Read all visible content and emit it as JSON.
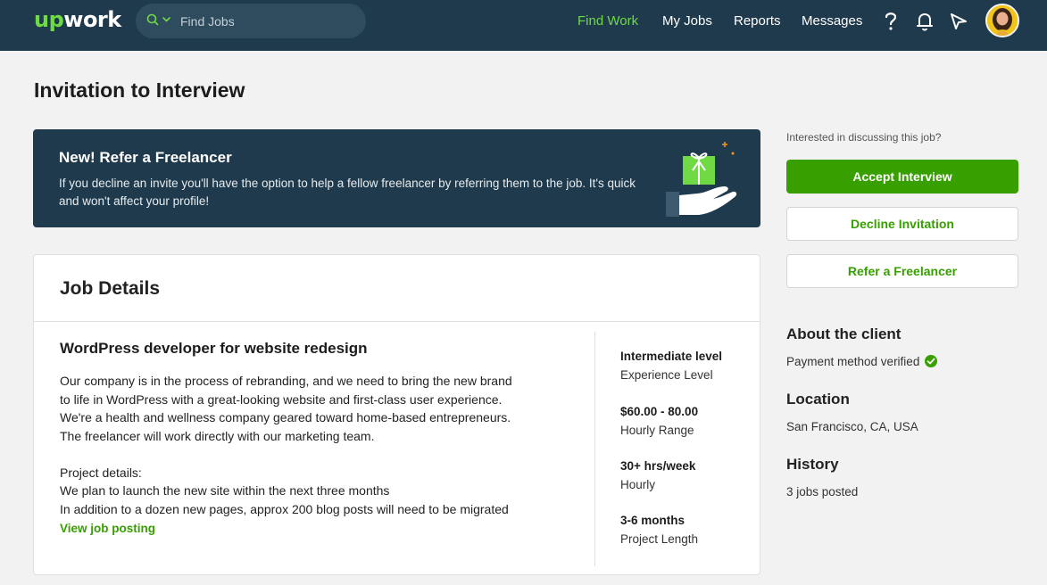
{
  "header": {
    "logo_up": "up",
    "logo_rest": "work",
    "search_placeholder": "Find Jobs",
    "nav": [
      "Find Work",
      "My Jobs",
      "Reports",
      "Messages"
    ],
    "icons": [
      "help-icon",
      "bell-icon",
      "send-icon"
    ]
  },
  "page": {
    "title": "Invitation to Interview"
  },
  "banner": {
    "title": "New! Refer a Freelancer",
    "text": "If you decline an invite you'll have the option to help a fellow freelancer by referring them to the job. It's quick and won't affect your profile!"
  },
  "job": {
    "section_title": "Job Details",
    "title": "WordPress developer for website redesign",
    "description_lines": [
      "Our company is in the process of rebranding, and we need to bring the new brand",
      "to life in WordPress with a great-looking website and first-class user experience.",
      "We're a health and wellness company geared toward home-based entrepreneurs.",
      "The freelancer will work directly with our marketing team.",
      "",
      "Project details:",
      "We plan to launch the new site within the next three months",
      "In addition to a dozen new pages, approx 200 blog posts will need to be migrated"
    ],
    "view_link": "View job posting",
    "meta": [
      {
        "value": "Intermediate level",
        "label": "Experience Level"
      },
      {
        "value": "$60.00 - 80.00",
        "label": "Hourly Range"
      },
      {
        "value": "30+ hrs/week",
        "label": "Hourly"
      },
      {
        "value": "3-6 months",
        "label": "Project Length"
      }
    ]
  },
  "sidebar": {
    "question": "Interested in discussing this job?",
    "accept": "Accept Interview",
    "decline": "Decline Invitation",
    "refer": "Refer a Freelancer",
    "client_heading": "About the client",
    "payment": "Payment method verified",
    "location_heading": "Location",
    "location": "San Francisco, CA, USA",
    "history_heading": "History",
    "history": "3 jobs posted"
  },
  "colors": {
    "nav_bg": "#1f3a4d",
    "accent": "#37a000",
    "active_nav": "#6fda44"
  }
}
